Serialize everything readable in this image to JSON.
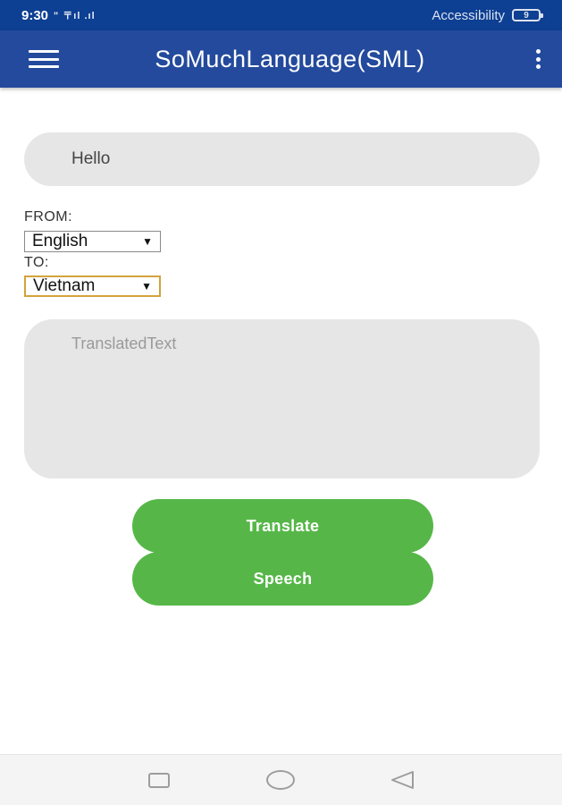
{
  "status_bar": {
    "time": "9:30",
    "indicators": "\" 〒ıl .ıl",
    "accessibility_label": "Accessibility",
    "battery_level": "9",
    "background_color": "#0d3f93"
  },
  "app_bar": {
    "title": "SoMuchLanguage(SML)",
    "background_color": "#234a9c",
    "menu_icon": "hamburger-menu-icon",
    "overflow_icon": "more-vert-icon"
  },
  "input": {
    "value": "Hello"
  },
  "language": {
    "from_label": "FROM:",
    "from_value": "English",
    "to_label": "TO:",
    "to_value": "Vietnam"
  },
  "output": {
    "placeholder": "TranslatedText"
  },
  "buttons": {
    "translate_label": "Translate",
    "speech_label": "Speech",
    "color": "#56b748"
  },
  "nav_bar": {
    "recents_icon": "square-icon",
    "home_icon": "circle-icon",
    "back_icon": "triangle-back-icon"
  }
}
